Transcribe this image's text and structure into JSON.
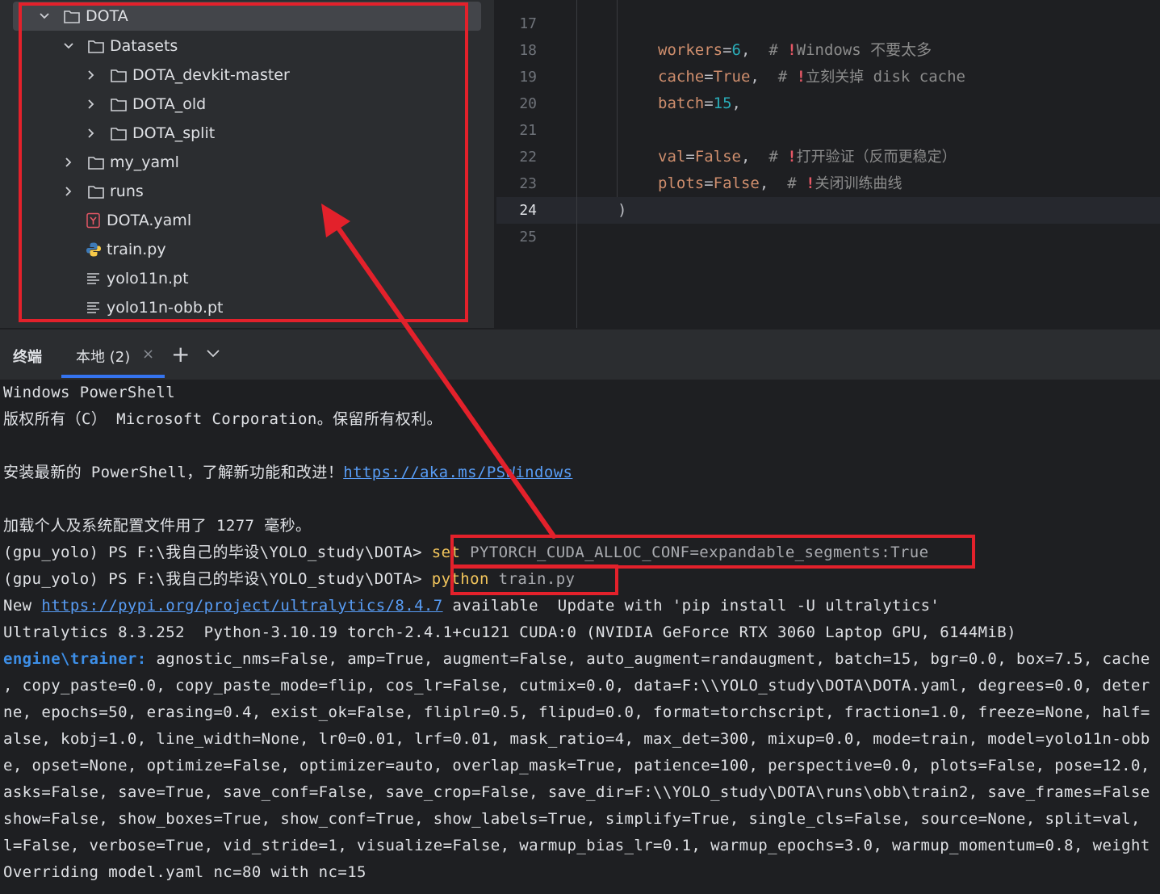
{
  "project_tree": {
    "items": [
      {
        "label": "DOTA",
        "type": "folder",
        "expanded": true,
        "depth": 0
      },
      {
        "label": "Datasets",
        "type": "folder",
        "expanded": true,
        "depth": 1
      },
      {
        "label": "DOTA_devkit-master",
        "type": "folder",
        "expanded": false,
        "depth": 2
      },
      {
        "label": "DOTA_old",
        "type": "folder",
        "expanded": false,
        "depth": 2
      },
      {
        "label": "DOTA_split",
        "type": "folder",
        "expanded": false,
        "depth": 2
      },
      {
        "label": "my_yaml",
        "type": "folder",
        "expanded": false,
        "depth": 1
      },
      {
        "label": "runs",
        "type": "folder",
        "expanded": false,
        "depth": 1
      },
      {
        "label": "DOTA.yaml",
        "type": "yaml",
        "depth": 1
      },
      {
        "label": "train.py",
        "type": "python",
        "depth": 1
      },
      {
        "label": "yolo11n.pt",
        "type": "text",
        "depth": 1
      },
      {
        "label": "yolo11n-obb.pt",
        "type": "text",
        "depth": 1
      }
    ]
  },
  "editor": {
    "line_numbers": [
      "17",
      "18",
      "19",
      "20",
      "21",
      "22",
      "23",
      "24",
      "25"
    ],
    "current_line": "24",
    "lines": {
      "l18": {
        "name": "workers",
        "value": "6",
        "comment": "Windows 不要太多"
      },
      "l19": {
        "name": "cache",
        "value": "True",
        "comment_cn": "立刻关掉",
        "comment_en": "disk cache"
      },
      "l20": {
        "name": "batch",
        "value": "15"
      },
      "l22": {
        "name": "val",
        "value": "False",
        "comment": "打开验证（反而更稳定）"
      },
      "l23": {
        "name": "plots",
        "value": "False",
        "comment": "关闭训练曲线"
      },
      "l24": {
        "text": ")"
      }
    }
  },
  "terminal_bar": {
    "title": "终端",
    "tab_label": "本地 (2)",
    "close_glyph": "×",
    "new_glyph": "+"
  },
  "terminal": {
    "l1": "Windows PowerShell",
    "l2": "版权所有（C） Microsoft Corporation。保留所有权利。",
    "l3_prefix": "安装最新的 PowerShell，了解新功能和改进！",
    "l3_link": "https://aka.ms/PSWindows",
    "l4": "加载个人及系统配置文件用了 1277 毫秒。",
    "prompt": "(gpu_yolo) PS F:\\我自己的毕设\\YOLO_study\\DOTA>",
    "cmd1_kw": "set",
    "cmd1_rest": "PYTORCH_CUDA_ALLOC_CONF=expandable_segments:True",
    "cmd2_kw": "python",
    "cmd2_rest": "train.py",
    "update_prefix": "New",
    "update_link": "https://pypi.org/project/ultralytics/8.4.7",
    "update_suffix": "available  Update with 'pip install -U ultralytics'",
    "ultralytics_info": "Ultralytics 8.3.252  Python-3.10.19 torch-2.4.1+cu121 CUDA:0 (NVIDIA GeForce RTX 3060 Laptop GPU, 6144MiB)",
    "trainer_label": "engine\\trainer:",
    "trainer_l1": "agnostic_nms=False, amp=True, augment=False, auto_augment=randaugment, batch=15, bgr=0.0, box=7.5, cache",
    "trainer_l2": ", copy_paste=0.0, copy_paste_mode=flip, cos_lr=False, cutmix=0.0, data=F:\\\\YOLO_study\\DOTA\\DOTA.yaml, degrees=0.0, deter",
    "trainer_l3": "ne, epochs=50, erasing=0.4, exist_ok=False, fliplr=0.5, flipud=0.0, format=torchscript, fraction=1.0, freeze=None, half=",
    "trainer_l4": "alse, kobj=1.0, line_width=None, lr0=0.01, lrf=0.01, mask_ratio=4, max_det=300, mixup=0.0, mode=train, model=yolo11n-obb",
    "trainer_l5": "e, opset=None, optimize=False, optimizer=auto, overlap_mask=True, patience=100, perspective=0.0, plots=False, pose=12.0,",
    "trainer_l6": "asks=False, save=True, save_conf=False, save_crop=False, save_dir=F:\\\\YOLO_study\\DOTA\\runs\\obb\\train2, save_frames=False",
    "trainer_l7": "show=False, show_boxes=True, show_conf=True, show_labels=True, simplify=True, single_cls=False, source=None, split=val,",
    "trainer_l8": "l=False, verbose=True, vid_stride=1, visualize=False, warmup_bias_lr=0.1, warmup_epochs=3.0, warmup_momentum=0.8, weight",
    "override": "Overriding model.yaml nc=80 with nc=15"
  },
  "colors": {
    "annotation_red": "#e3212b",
    "link_blue": "#589df6",
    "command_yellow": "#f2c55c"
  }
}
